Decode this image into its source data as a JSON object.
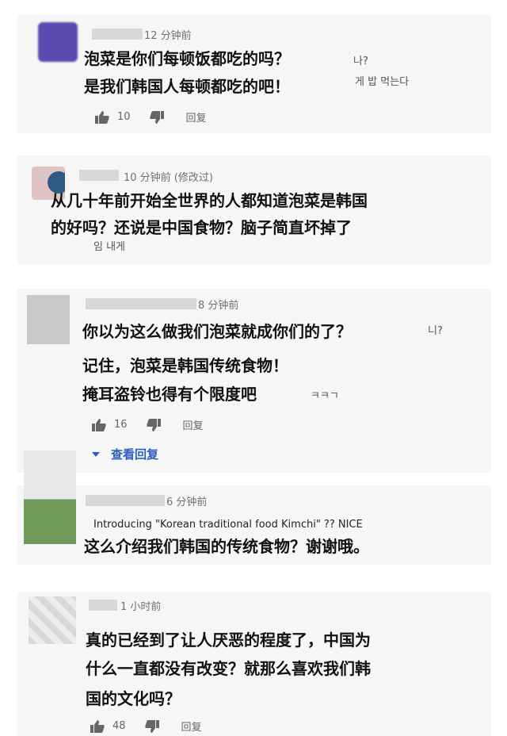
{
  "comments": [
    {
      "time": "12 分钟前",
      "lines": [
        "泡菜是你们每顿饭都吃的吗？",
        "是我们韩国人每顿都吃的吧！"
      ],
      "overlay": [
        "나?",
        "게 밥 먹는다"
      ],
      "likes": "10",
      "reply_label": "回复",
      "avatar_color": "#5a4bb0"
    },
    {
      "time": "10 分钟前  (修改过)",
      "lines": [
        "从几十年前开始全世界的人都知道泡菜是韩国",
        "的好吗？还说是中国食物？脑子简直坏掉了"
      ],
      "overlay": [
        "임 내게"
      ],
      "avatar_color": "#3b5f86"
    },
    {
      "time": "8 分钟前",
      "lines": [
        "你以为这么做我们泡菜就成你们的了？",
        "记住，泡菜是韩国传统食物！",
        "掩耳盗铃也得有个限度吧"
      ],
      "overlay": [
        "니?",
        "ㅋㅋㄱ"
      ],
      "likes": "16",
      "reply_label": "回复",
      "view_replies": "查看回复",
      "avatar_color": "#c9c9c9"
    },
    {
      "time": "6 分钟前",
      "english": "Introducing \"Korean traditional food Kimchi\" ?? NICE",
      "lines": [
        "这么介绍我们韩国的传统食物？谢谢哦。"
      ],
      "avatar_color": "#6f9a5a"
    },
    {
      "time": "1 小时前",
      "lines": [
        "真的已经到了让人厌恶的程度了，中国为",
        "什么一直都没有改变？就那么喜欢我们韩",
        "国的文化吗？"
      ],
      "likes": "48",
      "reply_label": "回复",
      "avatar_color": "#cfcfcf"
    }
  ]
}
